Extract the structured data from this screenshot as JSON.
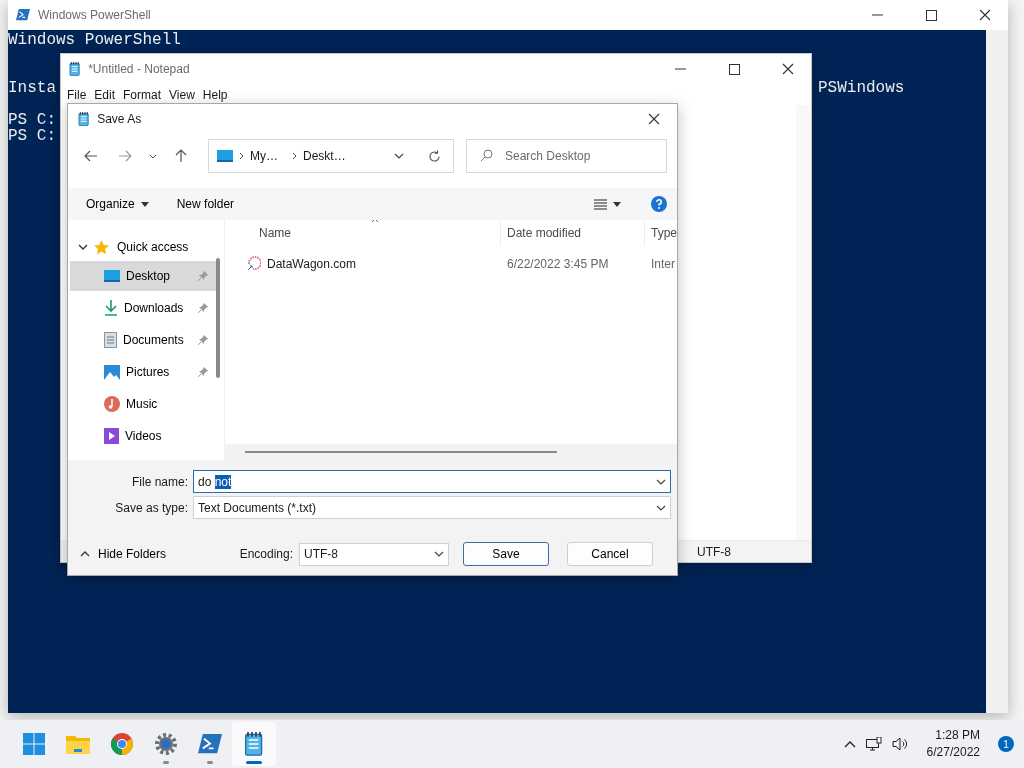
{
  "powershell": {
    "title": "Windows PowerShell",
    "lines": [
      {
        "kind": "text",
        "text": "Windows PowerShell"
      },
      {
        "kind": "blank"
      },
      {
        "kind": "blank"
      },
      {
        "kind": "text",
        "text": "Insta",
        "right": "PSWindows"
      },
      {
        "kind": "blank"
      },
      {
        "kind": "text",
        "text": "PS C:"
      },
      {
        "kind": "text",
        "text": "PS C:"
      }
    ]
  },
  "notepad": {
    "title": "*Untitled - Notepad",
    "menu": [
      "File",
      "Edit",
      "Format",
      "View",
      "Help"
    ],
    "status_encoding": "UTF-8"
  },
  "dialog": {
    "title": "Save As",
    "breadcrumb": [
      "My…",
      "Deskt…"
    ],
    "search": {
      "placeholder": "Search Desktop"
    },
    "toolbar": {
      "organize": "Organize",
      "new_folder": "New folder"
    },
    "sidebar": {
      "group": "Quick access",
      "expanded": true,
      "items": [
        {
          "label": "Desktop",
          "kind": "desktop",
          "pinned": true,
          "selected": true
        },
        {
          "label": "Downloads",
          "kind": "downloads",
          "pinned": true,
          "selected": false
        },
        {
          "label": "Documents",
          "kind": "documents",
          "pinned": true,
          "selected": false
        },
        {
          "label": "Pictures",
          "kind": "pictures",
          "pinned": true,
          "selected": false
        },
        {
          "label": "Music",
          "kind": "music",
          "pinned": false,
          "selected": false
        },
        {
          "label": "Videos",
          "kind": "videos",
          "pinned": false,
          "selected": false
        }
      ]
    },
    "columns": [
      "Name",
      "Date modified",
      "Type"
    ],
    "rows": [
      {
        "name": "DataWagon.com",
        "date": "6/22/2022 3:45 PM",
        "type": "Inter"
      }
    ],
    "file_name": {
      "label": "File name:",
      "value": "do ",
      "selected_value": "not"
    },
    "save_type": {
      "label": "Save as type:",
      "value": "Text Documents (*.txt)"
    },
    "hide_folders": "Hide Folders",
    "encoding": {
      "label": "Encoding:",
      "value": "UTF-8"
    },
    "buttons": [
      {
        "label": "Save",
        "default": true
      },
      {
        "label": "Cancel",
        "default": false
      }
    ]
  },
  "taskbar": {
    "apps": [
      {
        "kind": "start",
        "running": false,
        "active": false
      },
      {
        "kind": "folder",
        "running": false,
        "active": false
      },
      {
        "kind": "browser",
        "running": false,
        "active": false
      },
      {
        "kind": "settings",
        "running": true,
        "active": false
      },
      {
        "kind": "powershell",
        "running": true,
        "active": false
      },
      {
        "kind": "notepad",
        "running": true,
        "active": true
      }
    ],
    "time": "1:28 PM",
    "date": "6/27/2022",
    "notifications": "1"
  }
}
